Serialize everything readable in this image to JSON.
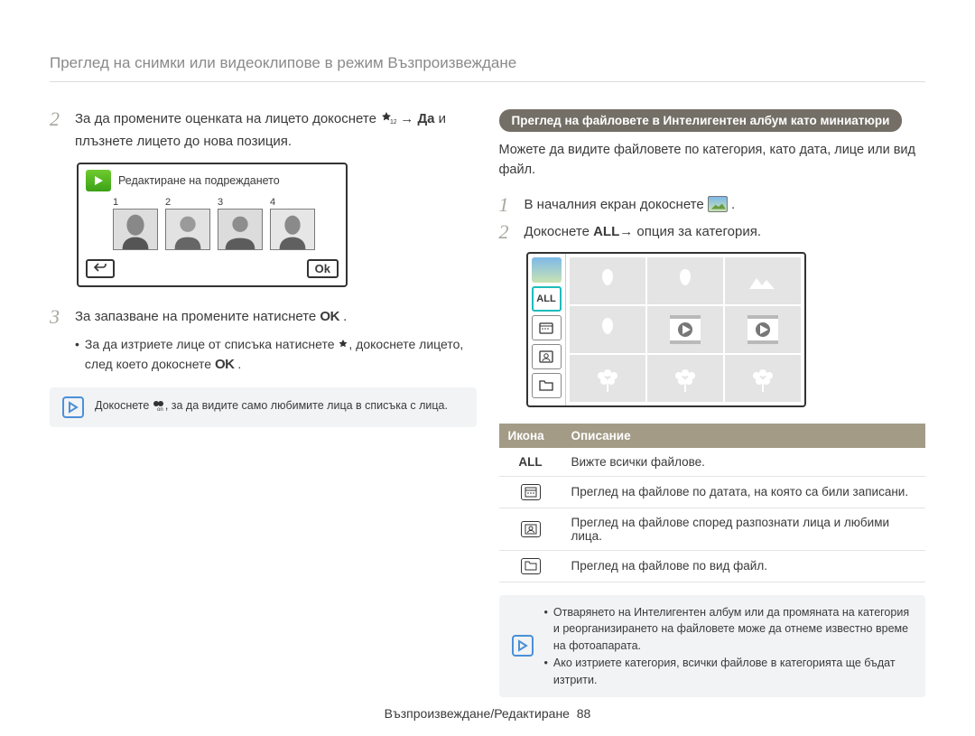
{
  "page_title": "Преглед на снимки или видеоклипове в режим Възпроизвеждане",
  "left": {
    "step2_a": "За да промените оценката на лицето докоснете ",
    "step2_b": " → ",
    "step2_c": "Да",
    "step2_d": " и плъзнете лицето до нова позиция.",
    "device_title": "Редактиране на подреждането",
    "faces": [
      "1",
      "2",
      "3",
      "4"
    ],
    "back_label": "↩",
    "ok_label": "Ok",
    "step3": "За запазване на промените натиснете ",
    "bullet_a": "За да изтриете лице от списъка натиснете ",
    "bullet_b": ", докоснете лицето, след което докоснете ",
    "note_a": "Докоснете ",
    "note_b": ", за да видите само любимите лица в списъка с лица."
  },
  "right": {
    "pill": "Преглед на файловете в Интелигентен албум като миниатюри",
    "intro": "Можете да видите файловете по категория, като дата, лице или вид файл.",
    "step1": "В началния екран докоснете ",
    "step2_a": "Докоснете ",
    "step2_all": "ALL",
    "step2_b": "→ опция за категория.",
    "sidebar_all": "ALL",
    "table": {
      "h_icon": "Икона",
      "h_desc": "Описание",
      "rows": [
        {
          "icon": "ALL",
          "desc": "Вижте всички файлове."
        },
        {
          "icon": "date",
          "desc": "Преглед на файлове по датата, на която са били записани."
        },
        {
          "icon": "face",
          "desc": "Преглед на файлове според разпознати лица и любими лица."
        },
        {
          "icon": "folder",
          "desc": "Преглед на файлове по вид файл."
        }
      ]
    },
    "note1": "Отварянето на Интелигентен албум или да промяната на категория и реорганизирането на файловете може да отнеме известно време на фотоапарата.",
    "note2": "Ако изтриете категория, всички файлове в категорията ще бъдат изтрити."
  },
  "footer_a": "Възпроизвеждане/Редактиране",
  "footer_page": "88"
}
